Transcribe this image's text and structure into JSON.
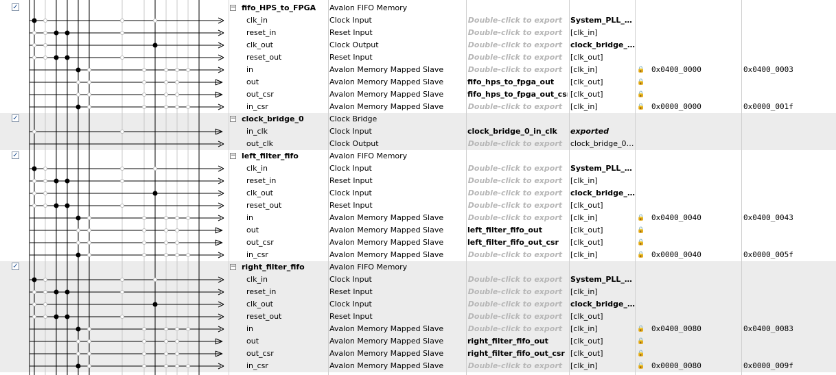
{
  "export_hint": "Double-click to export",
  "components": [
    {
      "name": "fifo_HPS_to_FPGA",
      "description": "Avalon FIFO Memory",
      "checked": true,
      "interfaces": [
        {
          "name": "clk_in",
          "desc": "Clock Input",
          "export": "",
          "clock": "System_PLL_s…",
          "clock_style": "bold",
          "base": "",
          "end": ""
        },
        {
          "name": "reset_in",
          "desc": "Reset Input",
          "export": "",
          "clock": "[clk_in]",
          "base": "",
          "end": ""
        },
        {
          "name": "clk_out",
          "desc": "Clock Output",
          "export": "",
          "clock": "clock_bridge_…",
          "clock_style": "bold",
          "base": "",
          "end": ""
        },
        {
          "name": "reset_out",
          "desc": "Reset Input",
          "export": "",
          "clock": "[clk_out]",
          "base": "",
          "end": ""
        },
        {
          "name": "in",
          "desc": "Avalon Memory Mapped Slave",
          "export": "",
          "clock": "[clk_in]",
          "lock": true,
          "base": "0x0400_0000",
          "end": "0x0400_0003"
        },
        {
          "name": "out",
          "desc": "Avalon Memory Mapped Slave",
          "export": "fifo_hps_to_fpga_out",
          "clock": "[clk_out]",
          "lock": true,
          "base": "",
          "end": ""
        },
        {
          "name": "out_csr",
          "desc": "Avalon Memory Mapped Slave",
          "export": "fifo_hps_to_fpga_out_csr",
          "clock": "[clk_out]",
          "lock": true,
          "base": "",
          "end": ""
        },
        {
          "name": "in_csr",
          "desc": "Avalon Memory Mapped Slave",
          "export": "",
          "clock": "[clk_in]",
          "lock": true,
          "base": "0x0000_0000",
          "end": "0x0000_001f"
        }
      ]
    },
    {
      "name": "clock_bridge_0",
      "description": "Clock Bridge",
      "checked": true,
      "interfaces": [
        {
          "name": "in_clk",
          "desc": "Clock Input",
          "export": "clock_bridge_0_in_clk",
          "clock": "exported",
          "clock_style": "exported",
          "base": "",
          "end": ""
        },
        {
          "name": "out_clk",
          "desc": "Clock Output",
          "export": "",
          "clock": "clock_bridge_0_…",
          "base": "",
          "end": ""
        }
      ]
    },
    {
      "name": "left_filter_fifo",
      "description": "Avalon FIFO Memory",
      "checked": true,
      "interfaces": [
        {
          "name": "clk_in",
          "desc": "Clock Input",
          "export": "",
          "clock": "System_PLL_s…",
          "clock_style": "bold",
          "base": "",
          "end": ""
        },
        {
          "name": "reset_in",
          "desc": "Reset Input",
          "export": "",
          "clock": "[clk_in]",
          "base": "",
          "end": ""
        },
        {
          "name": "clk_out",
          "desc": "Clock Input",
          "export": "",
          "clock": "clock_bridge_…",
          "clock_style": "bold",
          "base": "",
          "end": ""
        },
        {
          "name": "reset_out",
          "desc": "Reset Input",
          "export": "",
          "clock": "[clk_out]",
          "base": "",
          "end": ""
        },
        {
          "name": "in",
          "desc": "Avalon Memory Mapped Slave",
          "export": "",
          "clock": "[clk_in]",
          "lock": true,
          "base": "0x0400_0040",
          "end": "0x0400_0043"
        },
        {
          "name": "out",
          "desc": "Avalon Memory Mapped Slave",
          "export": "left_filter_fifo_out",
          "clock": "[clk_out]",
          "lock": true,
          "base": "",
          "end": ""
        },
        {
          "name": "out_csr",
          "desc": "Avalon Memory Mapped Slave",
          "export": "left_filter_fifo_out_csr",
          "clock": "[clk_out]",
          "lock": true,
          "base": "",
          "end": ""
        },
        {
          "name": "in_csr",
          "desc": "Avalon Memory Mapped Slave",
          "export": "",
          "clock": "[clk_in]",
          "lock": true,
          "base": "0x0000_0040",
          "end": "0x0000_005f"
        }
      ]
    },
    {
      "name": "right_filter_fifo",
      "description": "Avalon FIFO Memory",
      "checked": true,
      "interfaces": [
        {
          "name": "clk_in",
          "desc": "Clock Input",
          "export": "",
          "clock": "System_PLL_s…",
          "clock_style": "bold",
          "base": "",
          "end": ""
        },
        {
          "name": "reset_in",
          "desc": "Reset Input",
          "export": "",
          "clock": "[clk_in]",
          "base": "",
          "end": ""
        },
        {
          "name": "clk_out",
          "desc": "Clock Input",
          "export": "",
          "clock": "clock_bridge_…",
          "clock_style": "bold",
          "base": "",
          "end": ""
        },
        {
          "name": "reset_out",
          "desc": "Reset Input",
          "export": "",
          "clock": "[clk_out]",
          "base": "",
          "end": ""
        },
        {
          "name": "in",
          "desc": "Avalon Memory Mapped Slave",
          "export": "",
          "clock": "[clk_in]",
          "lock": true,
          "base": "0x0400_0080",
          "end": "0x0400_0083"
        },
        {
          "name": "out",
          "desc": "Avalon Memory Mapped Slave",
          "export": "right_filter_fifo_out",
          "clock": "[clk_out]",
          "lock": true,
          "base": "",
          "end": ""
        },
        {
          "name": "out_csr",
          "desc": "Avalon Memory Mapped Slave",
          "export": "right_filter_fifo_out_csr",
          "clock": "[clk_out]",
          "lock": true,
          "base": "",
          "end": ""
        },
        {
          "name": "in_csr",
          "desc": "Avalon Memory Mapped Slave",
          "export": "",
          "clock": "[clk_in]",
          "lock": true,
          "base": "0x0000_0080",
          "end": "0x0000_009f"
        }
      ]
    }
  ]
}
